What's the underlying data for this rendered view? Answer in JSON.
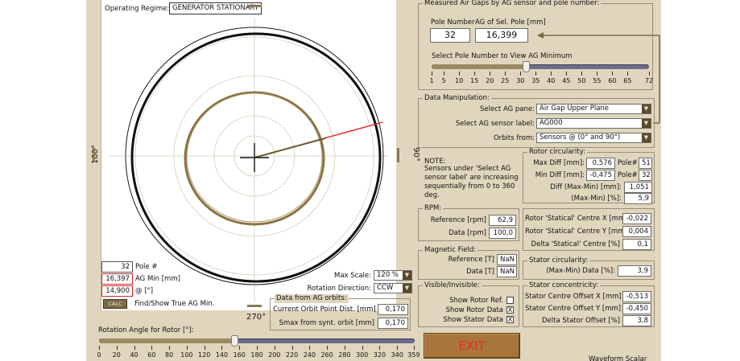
{
  "plot": {
    "regime_label": "Operating Regime:",
    "regime_value": "GENERATOR STATIONARY",
    "angle_top": "90°",
    "angle_left": "180°",
    "angle_right": "0°",
    "angle_bottom": "270°"
  },
  "left_readouts": {
    "pole_value": "32",
    "pole_label": "Pole #",
    "ag_min_value": "16,397",
    "ag_min_label": "AG Min [mm]",
    "angle_value": "14,900",
    "angle_label": "@ [°]",
    "calc_label": "CALC",
    "calc_desc": "Find/Show True AG Min."
  },
  "scale": {
    "max_scale_label": "Max Scale:",
    "max_scale_value": "120 %",
    "rotation_dir_label": "Rotation Direction:",
    "rotation_dir_value": "CCW"
  },
  "orbits": {
    "title": "Data from AG orbits:",
    "current_label": "Current Orbit Point Dist. [mm]",
    "current_value": "0,170",
    "smax_label": "Smax from synt. orbit [mm]",
    "smax_value": "0,170"
  },
  "rotation_slider": {
    "title": "Rotation Angle for Rotor [°]:",
    "value": 155,
    "min": 0,
    "max": 360,
    "ticks": [
      "0",
      "20",
      "40",
      "60",
      "80",
      "100",
      "120",
      "140",
      "160",
      "180",
      "200",
      "220",
      "240",
      "260",
      "280",
      "300",
      "320",
      "340",
      "359"
    ]
  },
  "measured": {
    "title": "Measured Air Gaps by AG sensor and pole number:",
    "pole_number_label": "Pole Number",
    "ag_label": "AG of Sel. Pole [mm]",
    "pole_number_value": "32",
    "ag_value": "16,399",
    "slider_label": "Select Pole Number to View AG Minimum",
    "slider_value": 32,
    "slider_min": 1,
    "slider_max": 72,
    "ticks": [
      "1",
      "5",
      "10",
      "15",
      "20",
      "25",
      "30",
      "35",
      "40",
      "45",
      "50",
      "55",
      "60",
      "65",
      "72"
    ]
  },
  "manipulation": {
    "title": "Data Manipulation:",
    "plane_label": "Select AG pane:",
    "plane_value": "Air Gap Upper Plane",
    "sensor_label": "Select AG sensor label:",
    "sensor_value": "AG000",
    "orbits_label": "Orbits from:",
    "orbits_value": "Sensors @ (0° and 90°)"
  },
  "note": {
    "title": "NOTE:",
    "text": "Sensors under 'Select AG sensor label' are increasing sequentially from 0 to 360 deg."
  },
  "rotor_circ": {
    "title": "Rotor circularity:",
    "max_label": "Max Diff [mm]:",
    "max_value": "0,576",
    "max_pole_label": "Pole#",
    "max_pole_value": "51",
    "min_label": "Min Diff [mm]:",
    "min_value": "-0,475",
    "min_pole_label": "Pole#",
    "min_pole_value": "32",
    "diff_label": "Diff (Max-Min) [mm]:",
    "diff_value": "1,051",
    "pct_label": "(Max-Min) [%]:",
    "pct_value": "5,9"
  },
  "rpm": {
    "title": "RPM:",
    "ref_label": "Reference [rpm]",
    "ref_value": "62,9",
    "data_label": "Data [rpm]",
    "data_value": "100,0"
  },
  "static_centre": {
    "x_label": "Rotor 'Statical' Centre X [mm]",
    "x_value": "-0,022",
    "y_label": "Rotor 'Statical' Centre Y [mm]",
    "y_value": "0,004",
    "delta_label": "Delta 'Statical' Centre [%]",
    "delta_value": "0,1"
  },
  "magnetic": {
    "title": "Magnetic Field:",
    "ref_label": "Reference [T]",
    "ref_value": "NaN",
    "data_label": "Data [T]",
    "data_value": "NaN"
  },
  "stator_circ": {
    "title": "Stator circularity:",
    "label": "(Max-Min) Data [%]:",
    "value": "3,9"
  },
  "visible": {
    "title": "Visible/Invisible:",
    "rotor_ref": "Show Rotor Ref.",
    "rotor_data": "Show Rotor Data",
    "stator_data": "Show Stator Data",
    "check_mark": "X"
  },
  "stator_conc": {
    "title": "Stator concentricity:",
    "x_label": "Stator Centre Offset X [mm]",
    "x_value": "-0,513",
    "y_label": "Stator Centre Offset Y [mm]",
    "y_value": "-0,450",
    "delta_label": "Delta Stator Offset [%]",
    "delta_value": "3,8"
  },
  "exit_label": "EXIT",
  "waveform_label": "Waveform Scalar",
  "colors": {
    "background": "#e0d6bd",
    "orbit": "#8a7243",
    "pointer": "#e0201a",
    "exit_text": "#e3321f"
  }
}
